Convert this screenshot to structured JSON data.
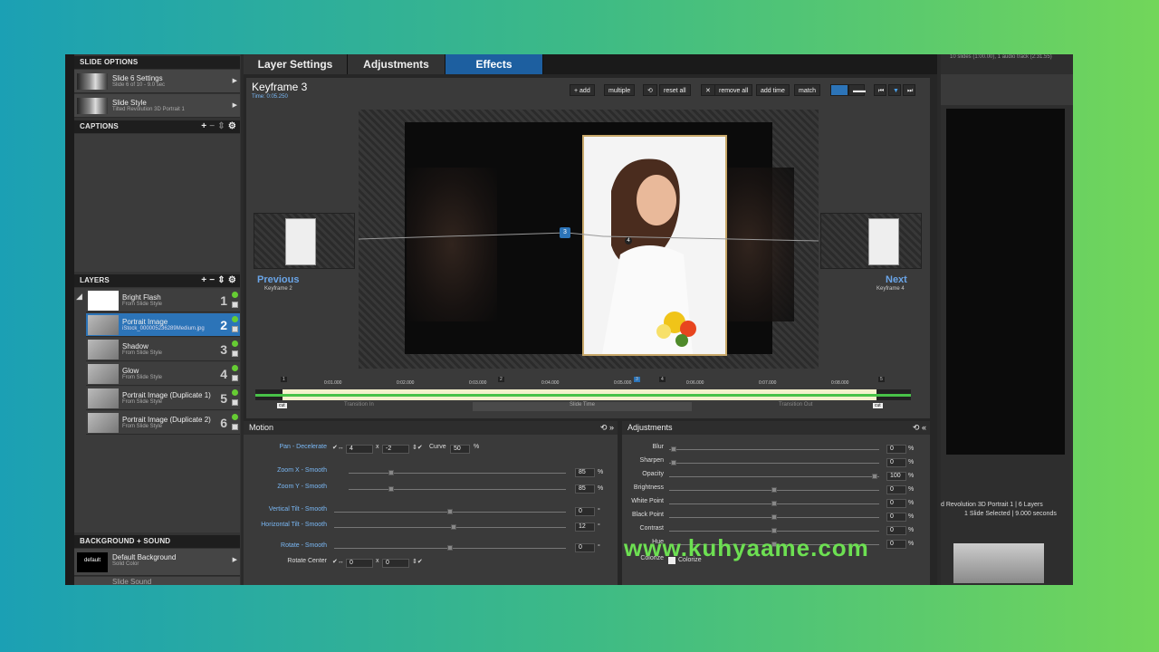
{
  "left_panel": {
    "slide_options_title": "SLIDE OPTIONS",
    "slide_settings": {
      "title": "Slide 6 Settings",
      "sub": "Slide 6 of 10 - 9.0 sec"
    },
    "slide_style": {
      "title": "Slide Style",
      "sub": "Tilted Revolution 3D Portrait 1"
    },
    "captions_title": "CAPTIONS",
    "layers_title": "LAYERS",
    "layers": [
      {
        "name": "Bright Flash",
        "sub": "From Slide Style",
        "num": "1"
      },
      {
        "name": "Portrait Image",
        "sub": "iStock_000005236289Medium.jpg",
        "num": "2"
      },
      {
        "name": "Shadow",
        "sub": "From Slide Style",
        "num": "3"
      },
      {
        "name": "Glow",
        "sub": "From Slide Style",
        "num": "4"
      },
      {
        "name": "Portrait Image (Duplicate 1)",
        "sub": "From Slide Style",
        "num": "5"
      },
      {
        "name": "Portrait Image (Duplicate 2)",
        "sub": "From Slide Style",
        "num": "6"
      }
    ],
    "bg_sound_title": "BACKGROUND + SOUND",
    "default_bg": {
      "title": "Default Background",
      "sub": "Solid Color",
      "thumb": "default"
    },
    "slide_sound": "Slide Sound"
  },
  "tabs": [
    {
      "label": "Layer Settings"
    },
    {
      "label": "Adjustments"
    },
    {
      "label": "Effects"
    }
  ],
  "keyframe": {
    "title": "Keyframe 3",
    "time": "Time: 0:05.250",
    "toolbar": {
      "add": "+ add",
      "multiple": "multiple",
      "reset_all": "reset all",
      "remove_all": "remove all",
      "add_time": "add time",
      "match": "match"
    },
    "previous": {
      "label": "Previous",
      "sub": "Keyframe 2",
      "num": "2"
    },
    "next": {
      "label": "Next",
      "sub": "Keyframe 4",
      "num": "4"
    }
  },
  "timeline": {
    "ticks": [
      "0:01.000",
      "0:02.000",
      "0:03.000",
      "0:04.000",
      "0:05.000",
      "0:06.000",
      "0:07.000",
      "0:08.000"
    ],
    "markers": [
      "1",
      "2",
      "3",
      "4",
      "5"
    ],
    "transition_in": "Transition In",
    "slide_time": "Slide Time",
    "transition_out": "Transition Out",
    "cut": "cut"
  },
  "motion": {
    "title": "Motion",
    "pan": {
      "label": "Pan - Decelerate",
      "x": "4",
      "y": "-2",
      "curve_label": "Curve",
      "curve": "50",
      "unit": "%"
    },
    "zoom_x": {
      "label": "Zoom X - Smooth",
      "value": "85",
      "unit": "%"
    },
    "zoom_y": {
      "label": "Zoom Y - Smooth",
      "value": "85",
      "unit": "%"
    },
    "vtilt": {
      "label": "Vertical Tilt - Smooth",
      "value": "0",
      "unit": "°"
    },
    "htilt": {
      "label": "Horizontal Tilt - Smooth",
      "value": "12",
      "unit": "°"
    },
    "rotate": {
      "label": "Rotate - Smooth",
      "value": "0",
      "unit": "°"
    },
    "rotate_center": {
      "label": "Rotate Center",
      "x": "0",
      "y": "0"
    }
  },
  "adjustments": {
    "title": "Adjustments",
    "rows": [
      {
        "label": "Blur",
        "value": "0",
        "unit": "%"
      },
      {
        "label": "Sharpen",
        "value": "0",
        "unit": "%"
      },
      {
        "label": "Opacity",
        "value": "100",
        "unit": "%"
      },
      {
        "label": "Brightness",
        "value": "0",
        "unit": "%"
      },
      {
        "label": "White Point",
        "value": "0",
        "unit": "%"
      },
      {
        "label": "Black Point",
        "value": "0",
        "unit": "%"
      },
      {
        "label": "Contrast",
        "value": "0",
        "unit": "%"
      },
      {
        "label": "Hue",
        "value": "0",
        "unit": "%"
      }
    ],
    "colorize_label": "Colorize",
    "colorize_check": "Colorize"
  },
  "right_panel": {
    "top_info": "10 slides (1:00.00), 1 audio track (2:31.55)",
    "style_info": "d Revolution 3D Portrait 1  |  6 Layers",
    "selected_info": "1 Slide Selected  |  9.000 seconds"
  },
  "watermark": "www.kuhyaame.com"
}
